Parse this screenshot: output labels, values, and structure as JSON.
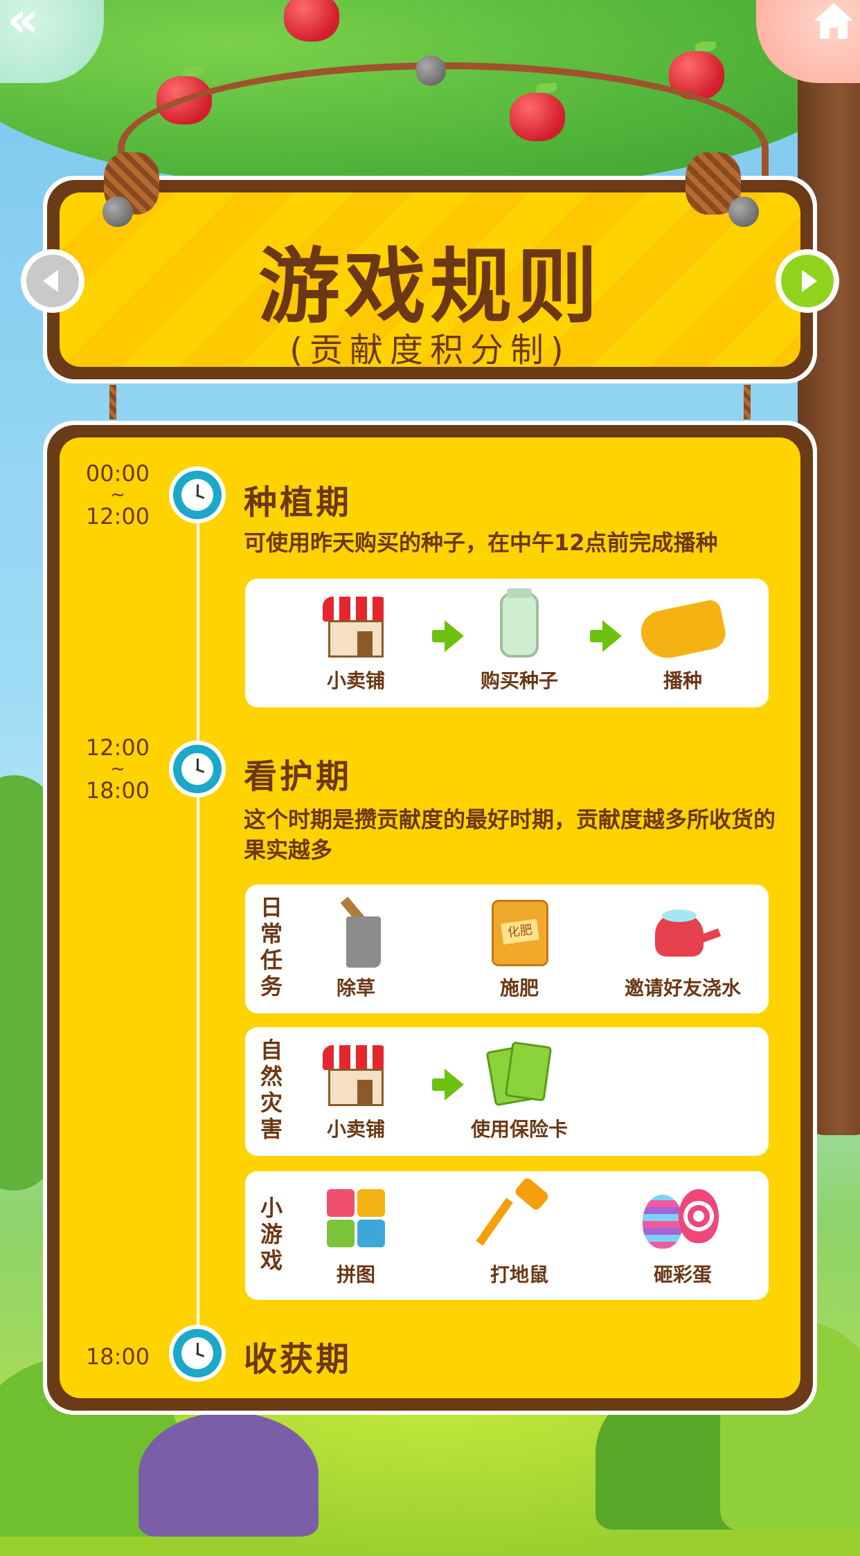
{
  "header": {
    "title": "游戏规则",
    "subtitle": "(贡献度积分制)"
  },
  "phases": [
    {
      "time_start": "00:00",
      "time_sep": "~",
      "time_end": "12:00",
      "title": "种植期",
      "desc": "可使用昨天购买的种子，在中午12点前完成播种",
      "steps": [
        {
          "icon": "shop-icon",
          "label": "小卖铺"
        },
        {
          "icon": "seed-jar-icon",
          "label": "购买种子"
        },
        {
          "icon": "glove-icon",
          "label": "播种"
        }
      ]
    },
    {
      "time_start": "12:00",
      "time_sep": "~",
      "time_end": "18:00",
      "title": "看护期",
      "desc": "这个时期是攒贡献度的最好时期，贡献度越多所收货的果实越多",
      "groups": [
        {
          "label": "日常任务",
          "items": [
            {
              "icon": "axe-icon",
              "label": "除草"
            },
            {
              "icon": "fertilizer-bag-icon",
              "label": "施肥",
              "tag": "化肥"
            },
            {
              "icon": "watering-can-icon",
              "label": "邀请好友浇水"
            }
          ]
        },
        {
          "label": "自然灾害",
          "items": [
            {
              "icon": "shop-icon",
              "label": "小卖铺"
            },
            {
              "icon": "insurance-card-icon",
              "label": "使用保险卡"
            }
          ]
        },
        {
          "label": "小游戏",
          "items": [
            {
              "icon": "puzzle-icon",
              "label": "拼图"
            },
            {
              "icon": "hammer-icon",
              "label": "打地鼠"
            },
            {
              "icon": "eggs-icon",
              "label": "砸彩蛋"
            }
          ]
        }
      ]
    },
    {
      "time_start": "18:00",
      "title": "收获期"
    }
  ],
  "colors": {
    "board_yellow": "#ffd300",
    "board_brown": "#6b3a16",
    "text_brown": "#6b3714",
    "clock_blue": "#1ba8c9",
    "arrow_green": "#6cc20f",
    "next_green": "#8fd31f",
    "prev_gray": "#c9c9c9"
  },
  "icons": {
    "back": "double-chevron-left-icon",
    "home": "home-icon",
    "prev": "arrow-left-icon",
    "next": "arrow-right-icon"
  }
}
